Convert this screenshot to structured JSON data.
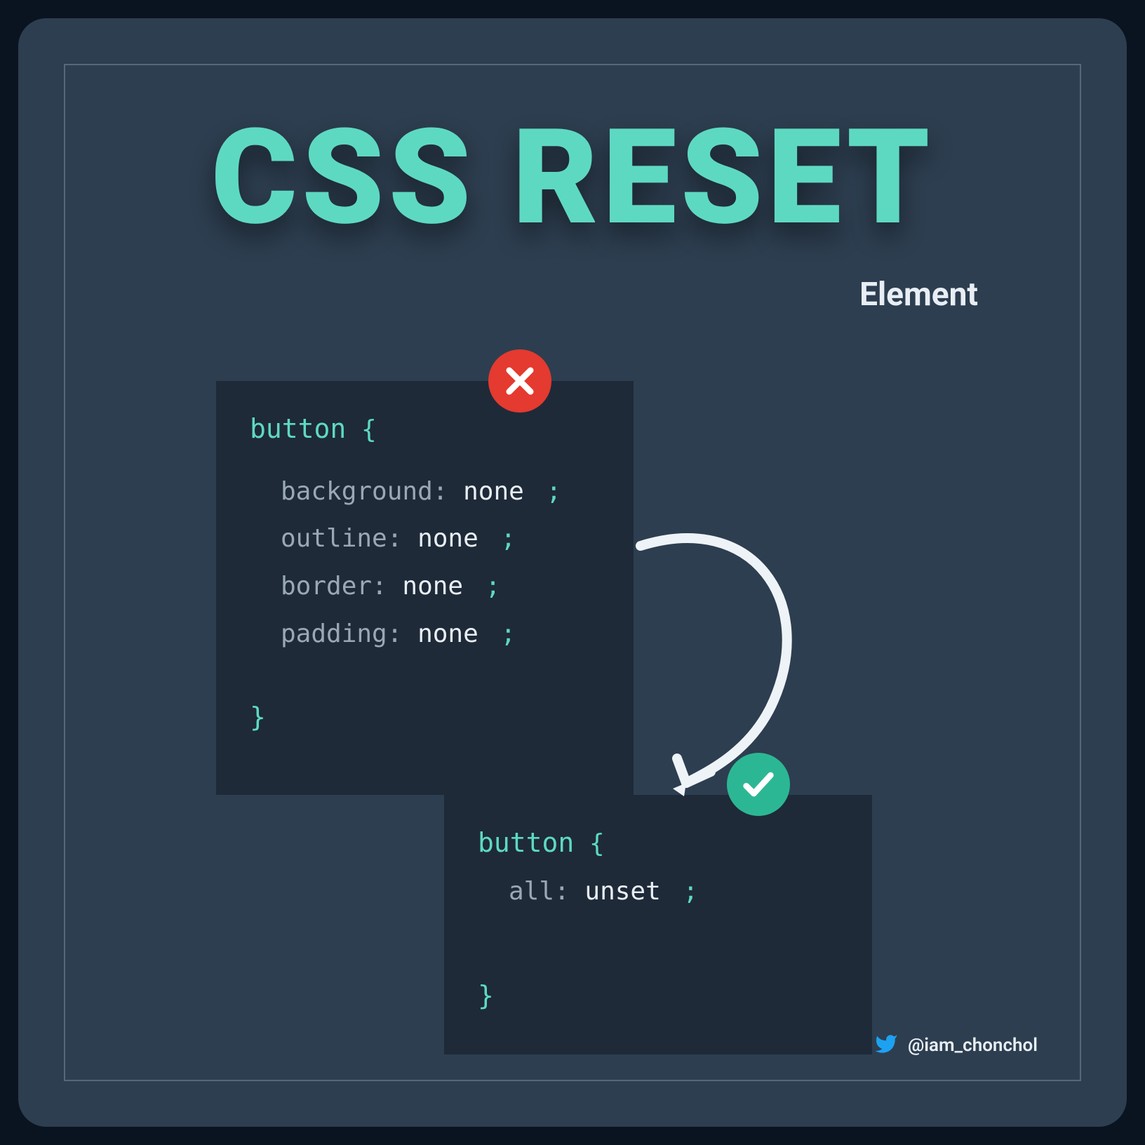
{
  "title": "CSS RESET",
  "subtitle": "Element",
  "bad_code": {
    "selector": "button",
    "open_brace": "{",
    "close_brace": "}",
    "declarations": [
      {
        "property": "background:",
        "value": "none",
        "semi": ";"
      },
      {
        "property": "outline:",
        "value": "none",
        "semi": ";"
      },
      {
        "property": "border:",
        "value": "none",
        "semi": ";"
      },
      {
        "property": "padding:",
        "value": "none",
        "semi": ";"
      }
    ]
  },
  "good_code": {
    "selector": "button",
    "open_brace": "{",
    "close_brace": "}",
    "declarations": [
      {
        "property": "all:",
        "value": "unset",
        "semi": ";"
      }
    ]
  },
  "footer": {
    "handle": "@iam_chonchol"
  },
  "colors": {
    "accent": "#5ed9c1",
    "bg": "#2d3e50",
    "code_bg": "#1e2a38",
    "bad": "#e43a2f",
    "good": "#2cb794"
  }
}
